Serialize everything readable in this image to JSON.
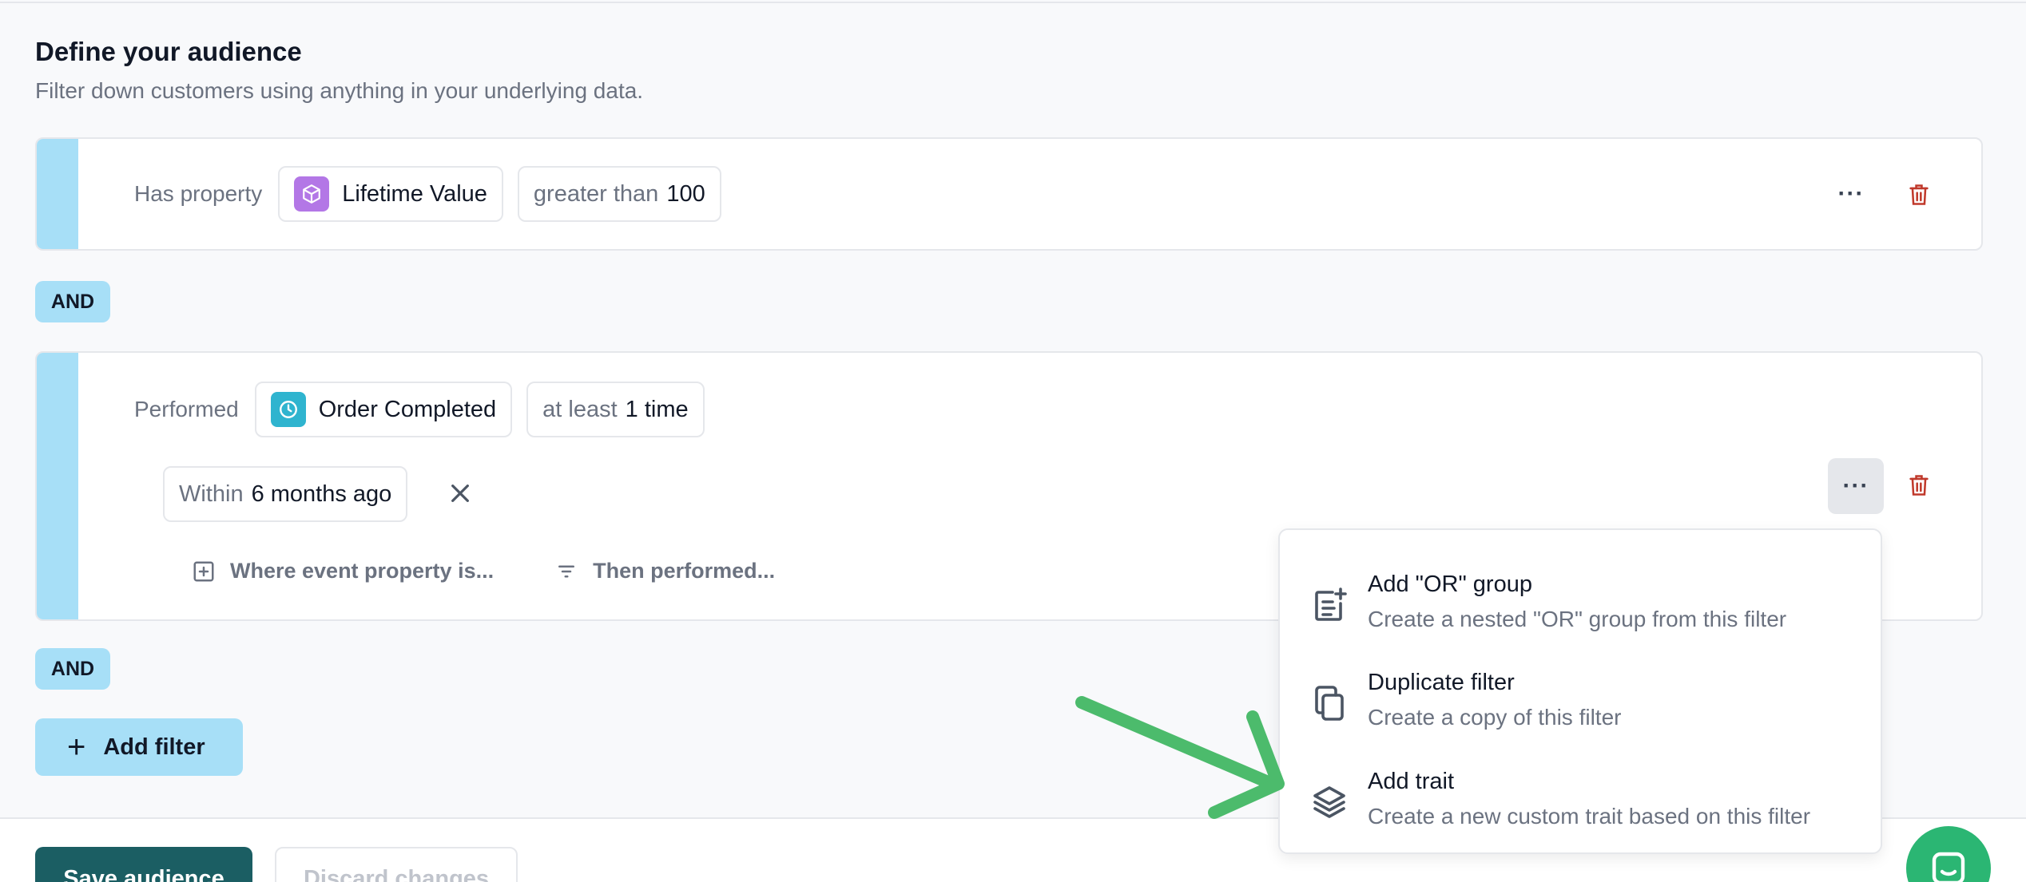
{
  "header": {
    "title": "Define your audience",
    "subtitle": "Filter down customers using anything in your underlying data."
  },
  "filters": [
    {
      "condition": "Has property",
      "entity": "Lifetime Value",
      "entity_icon": "cube-icon",
      "operator": "greater than",
      "value": "100",
      "more_label": "···"
    },
    {
      "condition": "Performed",
      "entity": "Order Completed",
      "entity_icon": "clock-icon",
      "operator": "at least",
      "value": "1 time",
      "time_prefix": "Within",
      "time_value": "6 months ago",
      "more_label": "···",
      "actions": [
        {
          "label": "Where event property is...",
          "icon": "plus-square-icon"
        },
        {
          "label": "Then performed...",
          "icon": "filter-lines-icon"
        }
      ]
    }
  ],
  "connectors": [
    "AND",
    "AND"
  ],
  "add_filter": {
    "icon": "+",
    "label": "Add filter"
  },
  "footer": {
    "save_label": "Save audience",
    "discard_label": "Discard changes"
  },
  "context_menu": {
    "items": [
      {
        "title": "Add \"OR\" group",
        "description": "Create a nested \"OR\" group from this filter",
        "icon": "add-group-icon"
      },
      {
        "title": "Duplicate filter",
        "description": "Create a copy of this filter",
        "icon": "copy-icon"
      },
      {
        "title": "Add trait",
        "description": "Create a new custom trait based on this filter",
        "icon": "layers-icon"
      }
    ]
  },
  "colors": {
    "accent": "#a7dff7",
    "primary_button": "#1b5e63",
    "delete": "#c0392b",
    "annotation_arrow": "#4cbb6c",
    "chat": "#2bb673"
  }
}
